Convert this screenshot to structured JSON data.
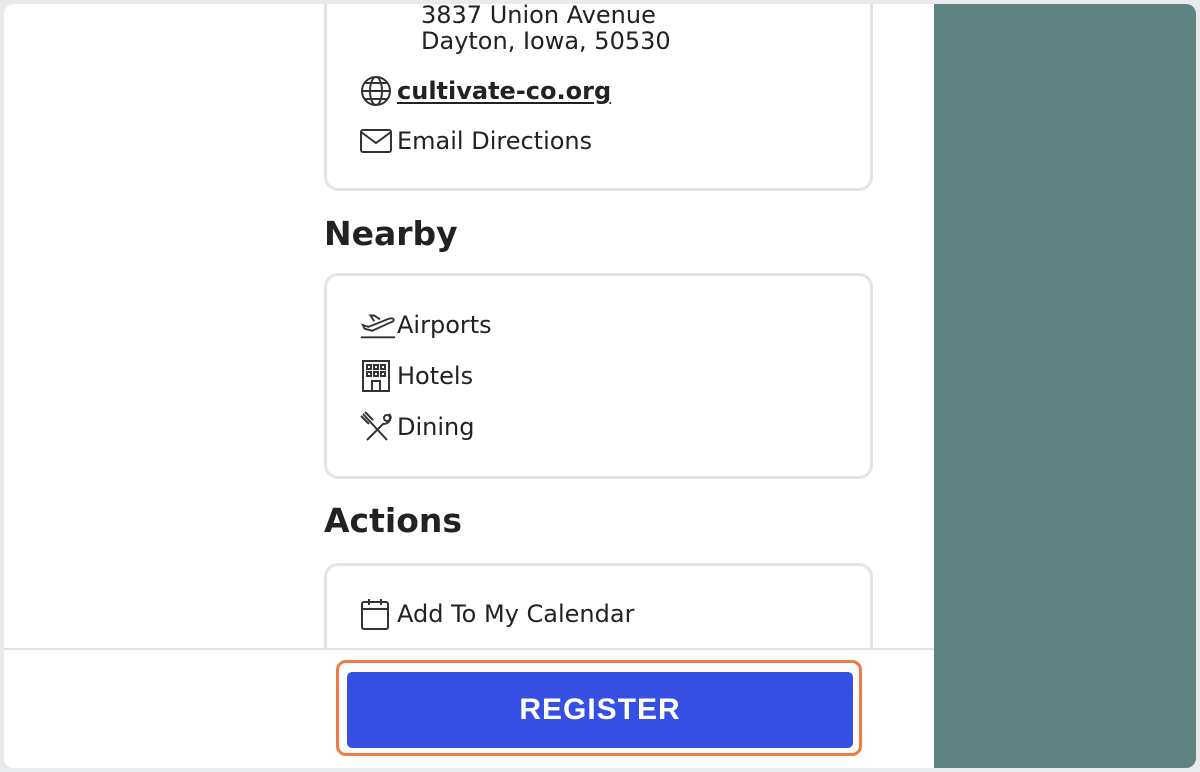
{
  "address": {
    "street": "3837 Union Avenue",
    "city_line": "Dayton, Iowa, 50530",
    "website": "cultivate-co.org",
    "email_directions": "Email Directions"
  },
  "nearby": {
    "title": "Nearby",
    "items": [
      {
        "label": "Airports",
        "icon": "airplane-icon"
      },
      {
        "label": "Hotels",
        "icon": "hotel-icon"
      },
      {
        "label": "Dining",
        "icon": "dining-icon"
      }
    ]
  },
  "actions": {
    "title": "Actions",
    "items": [
      {
        "label": "Add To My Calendar",
        "icon": "calendar-icon"
      }
    ]
  },
  "footer": {
    "register_label": "REGISTER"
  },
  "colors": {
    "accent": "#3550e3",
    "highlight": "#f07b45",
    "side_panel": "#5f8283"
  }
}
